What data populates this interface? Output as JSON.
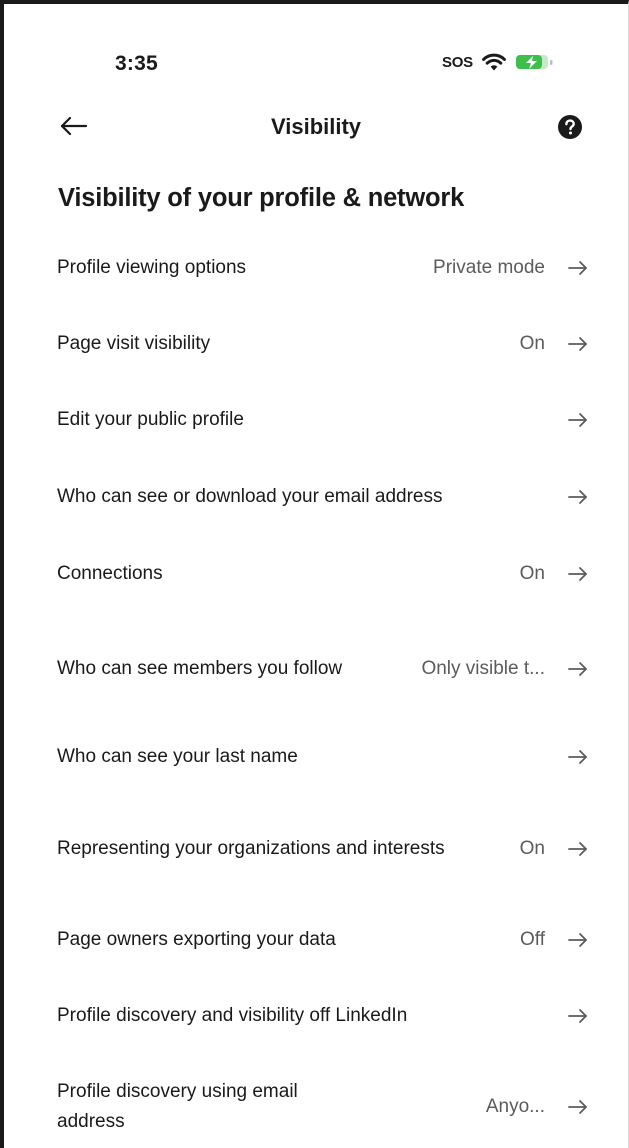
{
  "status_bar": {
    "time": "3:35",
    "sos": "SOS"
  },
  "header": {
    "title": "Visibility"
  },
  "section": {
    "title": "Visibility of your profile & network"
  },
  "rows": [
    {
      "label": "Profile viewing options",
      "value": "Private mode"
    },
    {
      "label": "Page visit visibility",
      "value": "On"
    },
    {
      "label": "Edit your public profile",
      "value": ""
    },
    {
      "label": "Who can see or download your email address",
      "value": ""
    },
    {
      "label": "Connections",
      "value": "On"
    },
    {
      "label": "Who can see members you follow",
      "value": "Only visible t..."
    },
    {
      "label": "Who can see your last name",
      "value": ""
    },
    {
      "label": "Representing your organizations and interests",
      "value": "On"
    },
    {
      "label": "Page owners exporting your data",
      "value": "Off"
    },
    {
      "label": "Profile discovery and visibility off LinkedIn",
      "value": ""
    },
    {
      "label": "Profile discovery using email address",
      "value": "Anyo..."
    }
  ],
  "icons": {
    "back": "arrow-left-icon",
    "help": "question-circle-icon",
    "row_arrow": "arrow-right-icon",
    "wifi": "wifi-icon",
    "battery": "battery-charging-icon"
  },
  "colors": {
    "text": "#1a1a1a",
    "secondary_text": "#5b5b5b",
    "arrow": "#5b5b5b",
    "battery": "#3cbf4b"
  }
}
